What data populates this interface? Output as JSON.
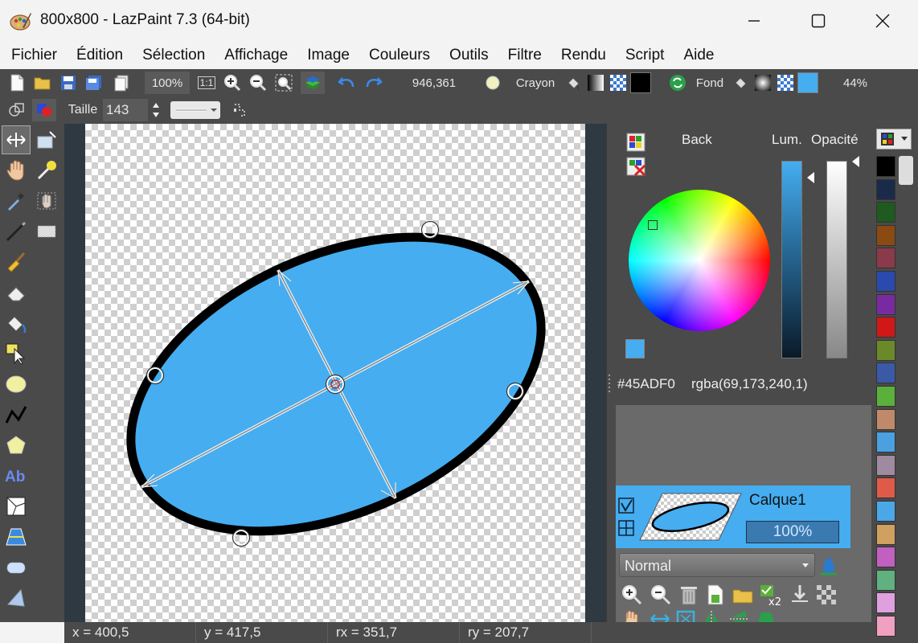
{
  "window": {
    "title": "800x800 - LazPaint 7.3 (64-bit)"
  },
  "menu": [
    "Fichier",
    "Édition",
    "Sélection",
    "Affichage",
    "Image",
    "Couleurs",
    "Outils",
    "Filtre",
    "Rendu",
    "Script",
    "Aide"
  ],
  "toolbar1": {
    "zoom": "100%",
    "zoom_1to1": "1:1",
    "cursor_coords": "946,361",
    "pen_label": "Crayon",
    "back_label": "Fond",
    "back_opacity": "44%"
  },
  "toolbar2": {
    "size_label": "Taille",
    "size_value": "143"
  },
  "color_panel": {
    "back_label": "Back",
    "lum_label": "Lum.",
    "opacity_label": "Opacité",
    "hex": "#45ADF0",
    "rgba": "rgba(69,173,240,1)",
    "current_color": "#45ADF0"
  },
  "layers": {
    "layer_name": "Calque1",
    "layer_opacity": "100%",
    "blend_mode": "Normal"
  },
  "status": {
    "x": "x = 400,5",
    "y": "y = 417,5",
    "rx": "rx = 351,7",
    "ry": "ry = 207,7"
  },
  "palette": [
    "#000000",
    "#1a2b4a",
    "#1f5a1f",
    "#8a4a12",
    "#8a3a4a",
    "#2a4ab0",
    "#7a2aa0",
    "#d01818",
    "#6a8a2a",
    "#3a5aa8",
    "#5ab03a",
    "#c08a6a",
    "#4aa0e0",
    "#a08aa0",
    "#e05a4a",
    "#4aa8e8",
    "#d0a060",
    "#c060c0",
    "#60b080",
    "#e0a0e0",
    "#f0a0c0"
  ],
  "icons": {
    "app": "lazpaint-icon",
    "minimize": "minimize-icon",
    "maximize": "maximize-icon",
    "close": "close-icon"
  }
}
